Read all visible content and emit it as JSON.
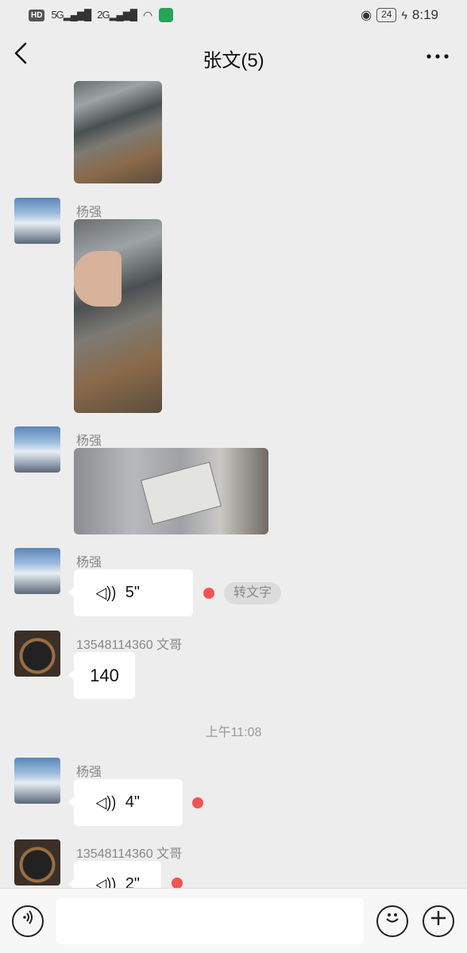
{
  "status_bar": {
    "hd": "HD",
    "sim1": "5G",
    "sim2": "2G",
    "battery": "24",
    "time": "8:19"
  },
  "nav": {
    "back_icon": "chevron-left-icon",
    "title": "张文(5)",
    "more_icon": "more-dots-icon"
  },
  "messages": [
    {
      "type": "image",
      "sender": "",
      "avatar": "snow-mountain-avatar"
    },
    {
      "type": "image",
      "sender": "杨强",
      "avatar": "snow-mountain-avatar"
    },
    {
      "type": "image",
      "sender": "杨强",
      "avatar": "snow-mountain-avatar"
    },
    {
      "type": "voice",
      "sender": "杨强",
      "duration": "5\"",
      "unread": true,
      "convert_label": "转文字",
      "avatar": "snow-mountain-avatar"
    },
    {
      "type": "text",
      "sender": "13548114360   文哥",
      "text": "140",
      "avatar": "car-interior-avatar"
    },
    {
      "type": "timestamp",
      "text": "上午11:08"
    },
    {
      "type": "voice",
      "sender": "杨强",
      "duration": "4\"",
      "unread": true,
      "avatar": "snow-mountain-avatar"
    },
    {
      "type": "voice",
      "sender": "13548114360   文哥",
      "duration": "2\"",
      "unread": true,
      "avatar": "car-interior-avatar"
    }
  ],
  "input_bar": {
    "voice_icon": "voice-toggle-icon",
    "placeholder": "",
    "emoji_icon": "emoji-icon",
    "plus_icon": "plus-icon"
  },
  "colors": {
    "background": "#ededed",
    "unread_dot": "#f15452",
    "bubble": "#ffffff"
  }
}
